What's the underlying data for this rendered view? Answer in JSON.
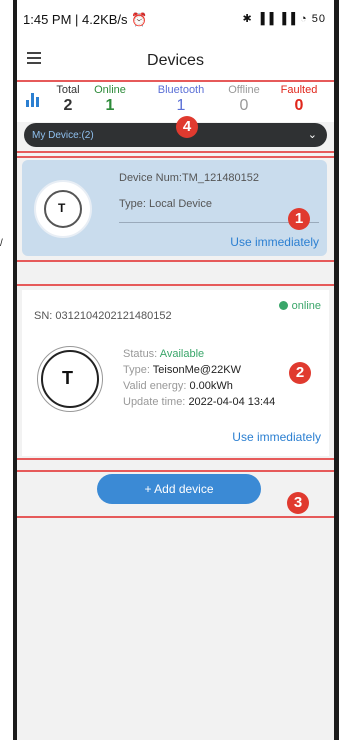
{
  "status_bar": {
    "time_net": "1:45 PM | 4.2KB/s",
    "alarm_glyph": "⏰",
    "icons_text": "✱ ▐▐ ▐▐ ◔ 50"
  },
  "header": {
    "title": "Devices",
    "menu_icon": "hamburger-icon"
  },
  "summary": {
    "stats": [
      {
        "label": "Total",
        "value": "2"
      },
      {
        "label": "Online",
        "value": "1"
      },
      {
        "label": "Bluetooth",
        "value": "1"
      },
      {
        "label": "Offline",
        "value": "0"
      },
      {
        "label": "Faulted",
        "value": "0"
      }
    ],
    "colors": {
      "total": "#333333",
      "online": "#2e8b3a",
      "bluetooth": "#5a6fd6",
      "offline": "#999999",
      "faulted": "#e0261b"
    }
  },
  "device_bar": {
    "label": "My Device:(2)",
    "chevron": "⌄"
  },
  "local_card": {
    "device_num": "Device Num:TM_121480152",
    "type": "Type:  Local Device",
    "use_label": "Use immediately"
  },
  "remote_card": {
    "sn": "SN:  0312104202121480152",
    "online_label": "online",
    "status_label": "Status:",
    "status_value": "Available",
    "type_label": "Type:",
    "type_value": "TeisonMe@22KW",
    "energy_label": "Valid energy:",
    "energy_value": "0.00kWh",
    "update_label": "Update time:",
    "update_value": "2022-04-04 13:44",
    "use_label": "Use immediately"
  },
  "add_device": {
    "label": "+  Add device"
  },
  "annotations": [
    "1",
    "2",
    "3",
    "4"
  ],
  "logo_letter": "T",
  "side_mark": "/"
}
